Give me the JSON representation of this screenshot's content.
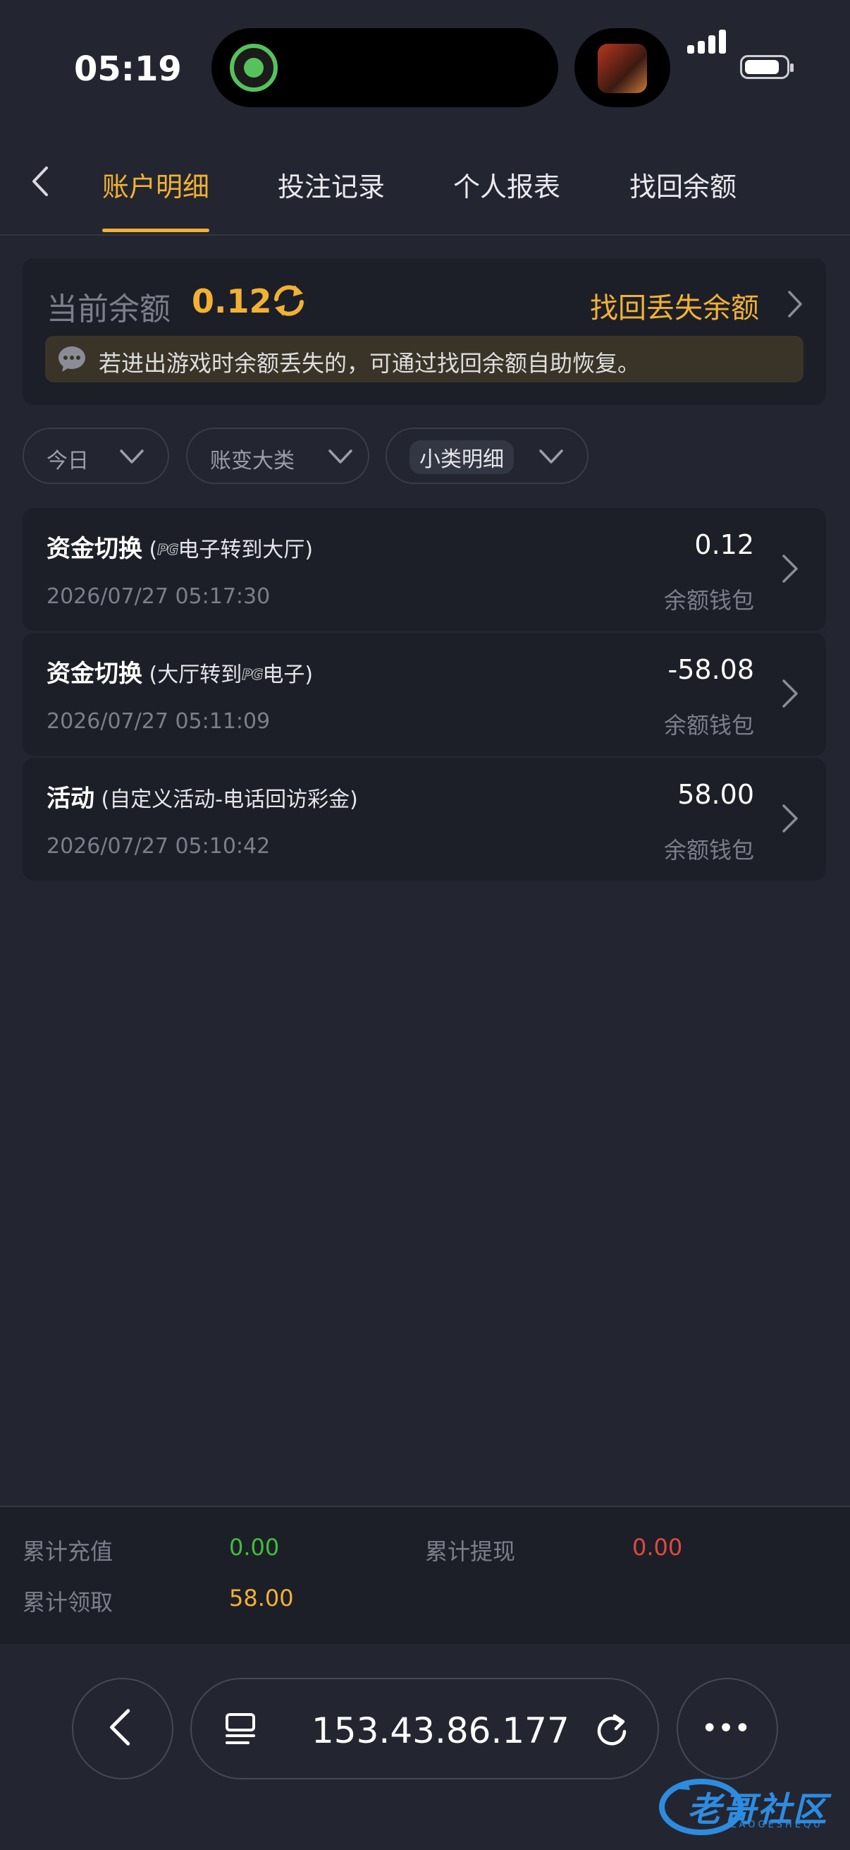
{
  "status_bar": {
    "time": "05:19"
  },
  "tabs": {
    "items": [
      {
        "label": "账户明细",
        "active": true
      },
      {
        "label": "投注记录",
        "active": false
      },
      {
        "label": "个人报表",
        "active": false
      },
      {
        "label": "找回余额",
        "active": false
      }
    ]
  },
  "balance": {
    "label": "当前余额",
    "value": "0.12",
    "recover_link": "找回丢失余额",
    "notice": "若进出游戏时余额丢失的，可通过找回余额自助恢复。"
  },
  "filters": [
    {
      "label": "今日"
    },
    {
      "label": "账变大类"
    },
    {
      "label": "小类明细"
    }
  ],
  "records": [
    {
      "title": "资金切换",
      "detail_pre": "(",
      "logo": "PG",
      "detail_post": "电子转到大厅)",
      "time": "2026/07/27 05:17:30",
      "amount": "0.12",
      "wallet": "余额钱包"
    },
    {
      "title": "资金切换",
      "detail_pre": "(大厅转到",
      "logo": "PG",
      "detail_post": "电子)",
      "time": "2026/07/27 05:11:09",
      "amount": "-58.08",
      "wallet": "余额钱包"
    },
    {
      "title": "活动",
      "detail_pre": "(自定义活动-电话回访彩金)",
      "logo": "",
      "detail_post": "",
      "time": "2026/07/27 05:10:42",
      "amount": "58.00",
      "wallet": "余额钱包"
    }
  ],
  "summary": {
    "recharge_label": "累计充值",
    "recharge_value": "0.00",
    "withdraw_label": "累计提现",
    "withdraw_value": "0.00",
    "claim_label": "累计领取",
    "claim_value": "58.00",
    "colors": {
      "recharge": "#3fbf3a",
      "withdraw": "#e0493f",
      "claim": "#f2b134"
    }
  },
  "browser": {
    "url": "153.43.86.177"
  },
  "watermark": {
    "text": "老哥社区",
    "sub": "LAOGESHEQU"
  },
  "colors": {
    "accent": "#f2b134",
    "background": "#232631",
    "card": "#1c1f28"
  }
}
